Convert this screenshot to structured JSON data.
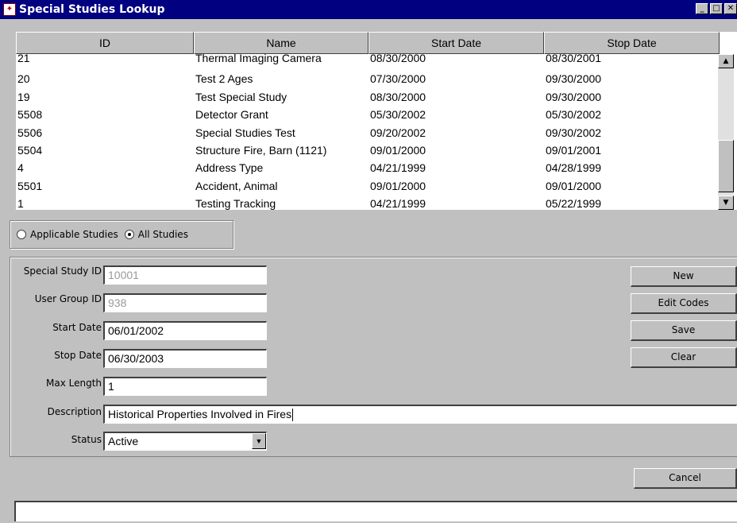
{
  "window": {
    "title": "Special Studies Lookup",
    "icon": "app-icon",
    "controls": [
      "minimize-icon",
      "maximize-icon",
      "close-icon"
    ]
  },
  "table": {
    "columns": [
      "ID",
      "Name",
      "Start Date",
      "Stop Date"
    ],
    "rows": [
      [
        "21",
        "Thermal Imaging Camera",
        "08/30/2000",
        "08/30/2001"
      ],
      [
        "20",
        "Test 2 Ages",
        "07/30/2000",
        "09/30/2000"
      ],
      [
        "19",
        "Test Special Study",
        "08/30/2000",
        "09/30/2000"
      ],
      [
        "5508",
        "Detector Grant",
        "05/30/2002",
        "05/30/2002"
      ],
      [
        "5506",
        "Special Studies Test",
        "09/20/2002",
        "09/30/2002"
      ],
      [
        "5504",
        "Structure Fire, Barn (1121)",
        "09/01/2000",
        "09/01/2001"
      ],
      [
        "4",
        "Address Type",
        "04/21/1999",
        "04/28/1999"
      ],
      [
        "5501",
        "Accident, Animal",
        "09/01/2000",
        "09/01/2000"
      ],
      [
        "1",
        "Testing Tracking",
        "04/21/1999",
        "05/22/1999"
      ]
    ]
  },
  "filter": {
    "applicable_label": "Applicable Studies",
    "all_label": "All Studies",
    "selected": "All Studies"
  },
  "form": {
    "special_study_id_label": "Special Study ID",
    "special_study_id": "10001",
    "user_group_id_label": "User Group ID",
    "user_group_id": "938",
    "start_date_label": "Start Date",
    "start_date": "06/01/2002",
    "stop_date_label": "Stop Date",
    "stop_date": "06/30/2003",
    "max_length_label": "Max Length",
    "max_length": "1",
    "description_label": "Description",
    "description": "Historical Properties Involved in Fires",
    "status_label": "Status",
    "status": "Active"
  },
  "buttons": {
    "new": "New",
    "edit_codes": "Edit Codes",
    "save": "Save",
    "clear": "Clear",
    "cancel": "Cancel"
  },
  "colors": {
    "titlebar": "#000080",
    "face": "#c0c0c0",
    "disabled_text": "#9a9a9a"
  }
}
